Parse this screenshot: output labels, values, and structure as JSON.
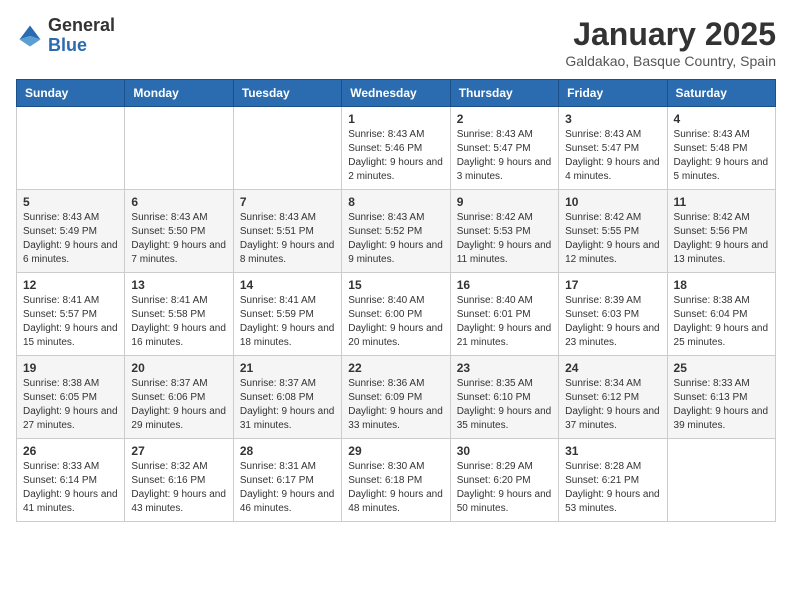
{
  "header": {
    "logo_general": "General",
    "logo_blue": "Blue",
    "month_title": "January 2025",
    "location": "Galdakao, Basque Country, Spain"
  },
  "calendar": {
    "days_of_week": [
      "Sunday",
      "Monday",
      "Tuesday",
      "Wednesday",
      "Thursday",
      "Friday",
      "Saturday"
    ],
    "weeks": [
      [
        {
          "day": "",
          "info": ""
        },
        {
          "day": "",
          "info": ""
        },
        {
          "day": "",
          "info": ""
        },
        {
          "day": "1",
          "info": "Sunrise: 8:43 AM\nSunset: 5:46 PM\nDaylight: 9 hours and 2 minutes."
        },
        {
          "day": "2",
          "info": "Sunrise: 8:43 AM\nSunset: 5:47 PM\nDaylight: 9 hours and 3 minutes."
        },
        {
          "day": "3",
          "info": "Sunrise: 8:43 AM\nSunset: 5:47 PM\nDaylight: 9 hours and 4 minutes."
        },
        {
          "day": "4",
          "info": "Sunrise: 8:43 AM\nSunset: 5:48 PM\nDaylight: 9 hours and 5 minutes."
        }
      ],
      [
        {
          "day": "5",
          "info": "Sunrise: 8:43 AM\nSunset: 5:49 PM\nDaylight: 9 hours and 6 minutes."
        },
        {
          "day": "6",
          "info": "Sunrise: 8:43 AM\nSunset: 5:50 PM\nDaylight: 9 hours and 7 minutes."
        },
        {
          "day": "7",
          "info": "Sunrise: 8:43 AM\nSunset: 5:51 PM\nDaylight: 9 hours and 8 minutes."
        },
        {
          "day": "8",
          "info": "Sunrise: 8:43 AM\nSunset: 5:52 PM\nDaylight: 9 hours and 9 minutes."
        },
        {
          "day": "9",
          "info": "Sunrise: 8:42 AM\nSunset: 5:53 PM\nDaylight: 9 hours and 11 minutes."
        },
        {
          "day": "10",
          "info": "Sunrise: 8:42 AM\nSunset: 5:55 PM\nDaylight: 9 hours and 12 minutes."
        },
        {
          "day": "11",
          "info": "Sunrise: 8:42 AM\nSunset: 5:56 PM\nDaylight: 9 hours and 13 minutes."
        }
      ],
      [
        {
          "day": "12",
          "info": "Sunrise: 8:41 AM\nSunset: 5:57 PM\nDaylight: 9 hours and 15 minutes."
        },
        {
          "day": "13",
          "info": "Sunrise: 8:41 AM\nSunset: 5:58 PM\nDaylight: 9 hours and 16 minutes."
        },
        {
          "day": "14",
          "info": "Sunrise: 8:41 AM\nSunset: 5:59 PM\nDaylight: 9 hours and 18 minutes."
        },
        {
          "day": "15",
          "info": "Sunrise: 8:40 AM\nSunset: 6:00 PM\nDaylight: 9 hours and 20 minutes."
        },
        {
          "day": "16",
          "info": "Sunrise: 8:40 AM\nSunset: 6:01 PM\nDaylight: 9 hours and 21 minutes."
        },
        {
          "day": "17",
          "info": "Sunrise: 8:39 AM\nSunset: 6:03 PM\nDaylight: 9 hours and 23 minutes."
        },
        {
          "day": "18",
          "info": "Sunrise: 8:38 AM\nSunset: 6:04 PM\nDaylight: 9 hours and 25 minutes."
        }
      ],
      [
        {
          "day": "19",
          "info": "Sunrise: 8:38 AM\nSunset: 6:05 PM\nDaylight: 9 hours and 27 minutes."
        },
        {
          "day": "20",
          "info": "Sunrise: 8:37 AM\nSunset: 6:06 PM\nDaylight: 9 hours and 29 minutes."
        },
        {
          "day": "21",
          "info": "Sunrise: 8:37 AM\nSunset: 6:08 PM\nDaylight: 9 hours and 31 minutes."
        },
        {
          "day": "22",
          "info": "Sunrise: 8:36 AM\nSunset: 6:09 PM\nDaylight: 9 hours and 33 minutes."
        },
        {
          "day": "23",
          "info": "Sunrise: 8:35 AM\nSunset: 6:10 PM\nDaylight: 9 hours and 35 minutes."
        },
        {
          "day": "24",
          "info": "Sunrise: 8:34 AM\nSunset: 6:12 PM\nDaylight: 9 hours and 37 minutes."
        },
        {
          "day": "25",
          "info": "Sunrise: 8:33 AM\nSunset: 6:13 PM\nDaylight: 9 hours and 39 minutes."
        }
      ],
      [
        {
          "day": "26",
          "info": "Sunrise: 8:33 AM\nSunset: 6:14 PM\nDaylight: 9 hours and 41 minutes."
        },
        {
          "day": "27",
          "info": "Sunrise: 8:32 AM\nSunset: 6:16 PM\nDaylight: 9 hours and 43 minutes."
        },
        {
          "day": "28",
          "info": "Sunrise: 8:31 AM\nSunset: 6:17 PM\nDaylight: 9 hours and 46 minutes."
        },
        {
          "day": "29",
          "info": "Sunrise: 8:30 AM\nSunset: 6:18 PM\nDaylight: 9 hours and 48 minutes."
        },
        {
          "day": "30",
          "info": "Sunrise: 8:29 AM\nSunset: 6:20 PM\nDaylight: 9 hours and 50 minutes."
        },
        {
          "day": "31",
          "info": "Sunrise: 8:28 AM\nSunset: 6:21 PM\nDaylight: 9 hours and 53 minutes."
        },
        {
          "day": "",
          "info": ""
        }
      ]
    ]
  }
}
